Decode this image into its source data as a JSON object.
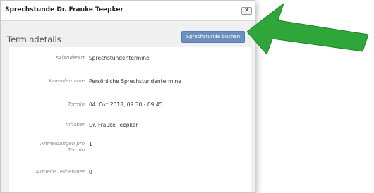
{
  "dialog": {
    "title": "Sprechstunde Dr. Frauke Teepker",
    "close_label": "✕"
  },
  "section": {
    "title": "Termindetails",
    "book_button": "Sprechstunde buchen"
  },
  "details": [
    {
      "label": "Kalenderart",
      "value": "Sprechstundentermine"
    },
    {
      "label": "Kalendername",
      "value": "Persönliche Sprechstundentermine"
    },
    {
      "label": "Termin",
      "value": "04. Okt 2018, 09:30 - 09:45"
    },
    {
      "label": "Inhaber",
      "value": "Dr. Frauke Teepker"
    },
    {
      "label": "Anmeldungen pro Termin",
      "value": "1"
    },
    {
      "label": "Aktuelle Teilnehmer",
      "value": "0"
    }
  ],
  "colors": {
    "button": "#6a8fc0",
    "arrow": "#2fa63a",
    "body_bg": "#f0f0f0"
  },
  "icons": {
    "close": "close-icon",
    "arrow": "green-arrow-icon"
  }
}
